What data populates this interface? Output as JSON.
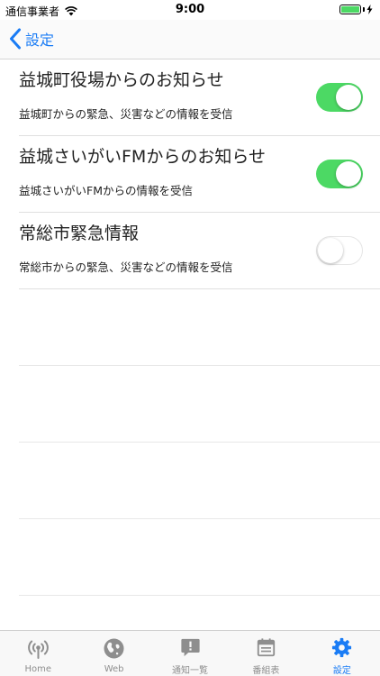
{
  "status_bar": {
    "carrier": "通信事業者",
    "time": "9:00"
  },
  "nav": {
    "back_label": "設定"
  },
  "settings": [
    {
      "title": "益城町役場からのお知らせ",
      "subtitle": "益城町からの緊急、災害などの情報を受信",
      "enabled": true
    },
    {
      "title": "益城さいがいFMからのお知らせ",
      "subtitle": "益城さいがいFMからの情報を受信",
      "enabled": true
    },
    {
      "title": "常総市緊急情報",
      "subtitle": "常総市からの緊急、災害などの情報を受信",
      "enabled": false
    }
  ],
  "tabs": [
    {
      "label": "Home",
      "icon": "radio-tower-icon",
      "active": false
    },
    {
      "label": "Web",
      "icon": "globe-icon",
      "active": false
    },
    {
      "label": "通知一覧",
      "icon": "alert-bubble-icon",
      "active": false
    },
    {
      "label": "番組表",
      "icon": "calendar-icon",
      "active": false
    },
    {
      "label": "設定",
      "icon": "gear-icon",
      "active": true
    }
  ],
  "colors": {
    "accent": "#1a7cf5",
    "switch_on": "#4cd964",
    "tab_inactive": "#8e8e8e"
  }
}
